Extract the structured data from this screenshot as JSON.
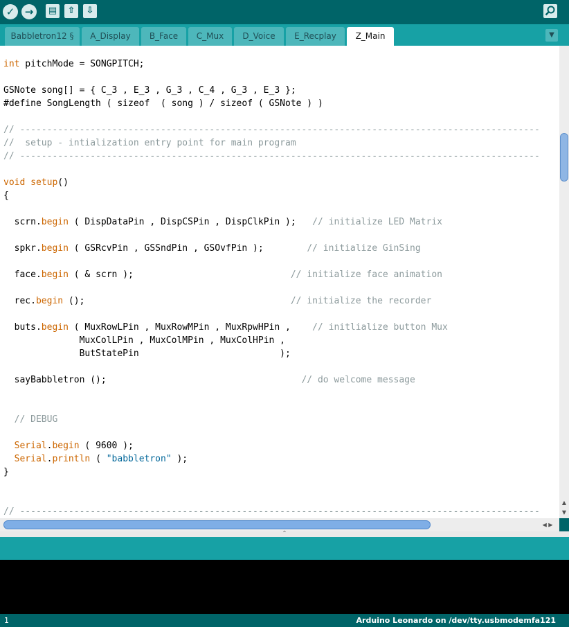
{
  "toolbar": {
    "buttons": [
      {
        "name": "verify",
        "icon": "check-icon",
        "glyph": "✓"
      },
      {
        "name": "upload",
        "icon": "arrow-right-icon",
        "glyph": "→"
      },
      {
        "name": "new",
        "icon": "document-icon",
        "glyph": "▤"
      },
      {
        "name": "open",
        "icon": "arrow-up-icon",
        "glyph": "⇧"
      },
      {
        "name": "save",
        "icon": "arrow-down-icon",
        "glyph": "⇩"
      }
    ],
    "serial_monitor_icon": "magnifier-icon"
  },
  "tabs": [
    {
      "label": "Babbletron12 §",
      "active": false
    },
    {
      "label": "A_Display",
      "active": false
    },
    {
      "label": "B_Face",
      "active": false
    },
    {
      "label": "C_Mux",
      "active": false
    },
    {
      "label": "D_Voice",
      "active": false
    },
    {
      "label": "E_Recplay",
      "active": false
    },
    {
      "label": "Z_Main",
      "active": true
    }
  ],
  "code_lines": [
    [
      {
        "t": "int",
        "c": "kw"
      },
      {
        "t": " pitchMode = SONGPITCH;"
      }
    ],
    [],
    [
      {
        "t": "GSNote song[] = { C_3 , E_3 , G_3 , C_4 , G_3 , E_3 };"
      }
    ],
    [
      {
        "t": "#define SongLength ( sizeof  ( song ) / sizeof ( GSNote ) )"
      }
    ],
    [],
    [
      {
        "t": "// ------------------------------------------------------------------------------------------------",
        "c": "cmt"
      }
    ],
    [
      {
        "t": "//  setup - intialization entry point for main program",
        "c": "cmt"
      }
    ],
    [
      {
        "t": "// ------------------------------------------------------------------------------------------------",
        "c": "cmt"
      }
    ],
    [],
    [
      {
        "t": "void",
        "c": "kw"
      },
      {
        "t": " "
      },
      {
        "t": "setup",
        "c": "kw"
      },
      {
        "t": "()"
      }
    ],
    [
      {
        "t": "{"
      }
    ],
    [],
    [
      {
        "t": "  scrn."
      },
      {
        "t": "begin",
        "c": "kw"
      },
      {
        "t": " ( DispDataPin , DispCSPin , DispClkPin );   "
      },
      {
        "t": "// initialize LED Matrix",
        "c": "cmt"
      }
    ],
    [],
    [
      {
        "t": "  spkr."
      },
      {
        "t": "begin",
        "c": "kw"
      },
      {
        "t": " ( GSRcvPin , GSSndPin , GSOvfPin );        "
      },
      {
        "t": "// initialize GinSing",
        "c": "cmt"
      }
    ],
    [],
    [
      {
        "t": "  face."
      },
      {
        "t": "begin",
        "c": "kw"
      },
      {
        "t": " ( & scrn );                             "
      },
      {
        "t": "// initialize face animation",
        "c": "cmt"
      }
    ],
    [],
    [
      {
        "t": "  rec."
      },
      {
        "t": "begin",
        "c": "kw"
      },
      {
        "t": " ();                                      "
      },
      {
        "t": "// initialize the recorder",
        "c": "cmt"
      }
    ],
    [],
    [
      {
        "t": "  buts."
      },
      {
        "t": "begin",
        "c": "kw"
      },
      {
        "t": " ( MuxRowLPin , MuxRowMPin , MuxRpwHPin ,    "
      },
      {
        "t": "// initlialize button Mux",
        "c": "cmt"
      }
    ],
    [
      {
        "t": "              MuxColLPin , MuxColMPin , MuxColHPin ,"
      }
    ],
    [
      {
        "t": "              ButStatePin                          );"
      }
    ],
    [],
    [
      {
        "t": "  sayBabbletron ();                                    "
      },
      {
        "t": "// do welcome message",
        "c": "cmt"
      }
    ],
    [],
    [],
    [
      {
        "t": "  // DEBUG",
        "c": "cmt"
      }
    ],
    [],
    [
      {
        "t": "  "
      },
      {
        "t": "Serial",
        "c": "kw"
      },
      {
        "t": "."
      },
      {
        "t": "begin",
        "c": "kw"
      },
      {
        "t": " ( 9600 );"
      }
    ],
    [
      {
        "t": "  "
      },
      {
        "t": "Serial",
        "c": "kw"
      },
      {
        "t": "."
      },
      {
        "t": "println",
        "c": "kw"
      },
      {
        "t": " ( "
      },
      {
        "t": "\"babbletron\"",
        "c": "str"
      },
      {
        "t": " );"
      }
    ],
    [
      {
        "t": "}"
      }
    ],
    [],
    [],
    [
      {
        "t": "// ------------------------------------------------------------------------------------------------",
        "c": "cmt"
      }
    ]
  ],
  "status": {
    "line_number": "1",
    "board": "Arduino Leonardo on /dev/tty.usbmodemfa121"
  }
}
